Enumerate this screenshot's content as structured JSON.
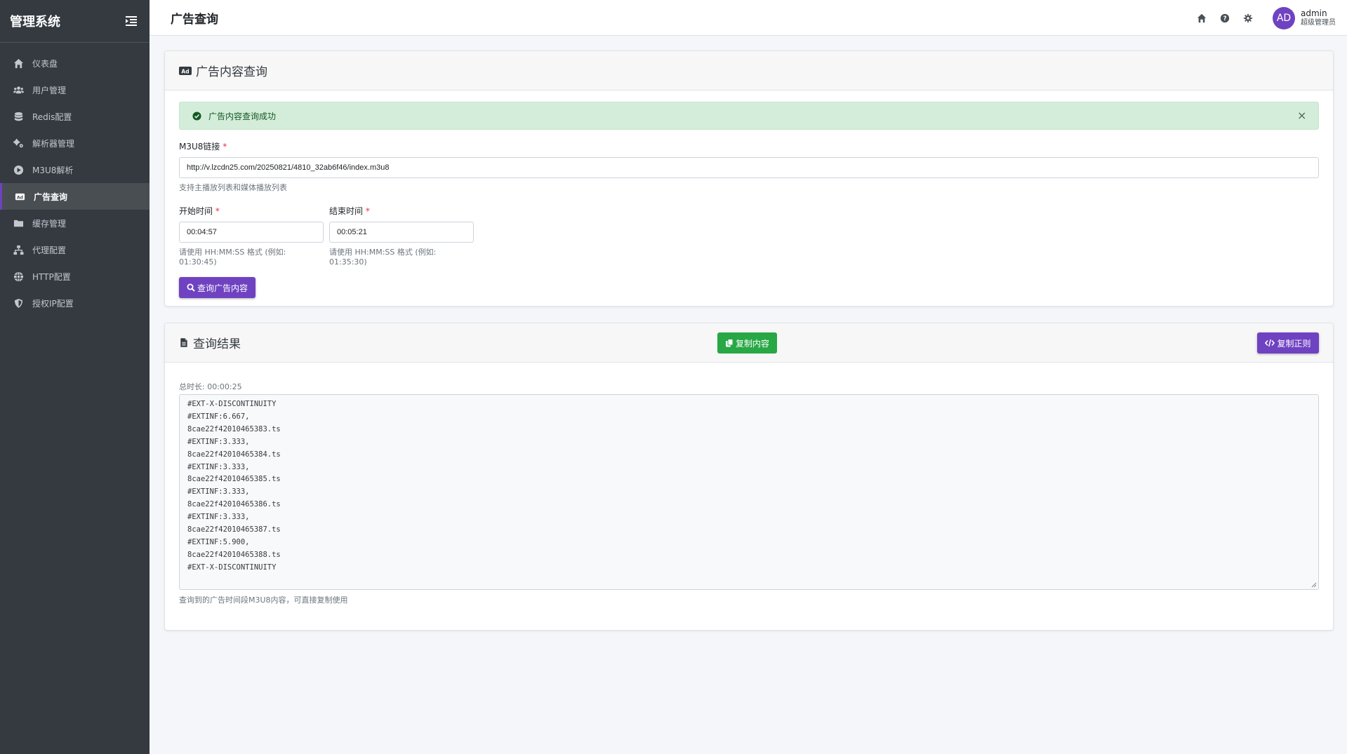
{
  "sidebar": {
    "brand": "管理系统",
    "items": [
      {
        "label": "仪表盘",
        "icon": "home-icon"
      },
      {
        "label": "用户管理",
        "icon": "users-icon"
      },
      {
        "label": "Redis配置",
        "icon": "database-icon"
      },
      {
        "label": "解析器管理",
        "icon": "gears-icon"
      },
      {
        "label": "M3U8解析",
        "icon": "play-circle-icon"
      },
      {
        "label": "广告查询",
        "icon": "ad-icon",
        "active": true
      },
      {
        "label": "缓存管理",
        "icon": "folder-icon"
      },
      {
        "label": "代理配置",
        "icon": "sitemap-icon"
      },
      {
        "label": "HTTP配置",
        "icon": "globe-icon"
      },
      {
        "label": "授权IP配置",
        "icon": "shield-icon"
      }
    ]
  },
  "header": {
    "title": "广告查询",
    "avatar_initials": "AD",
    "user_name": "admin",
    "user_role": "超级管理员"
  },
  "query_card": {
    "title": "广告内容查询",
    "alert_text": "广告内容查询成功",
    "alert_close": "×",
    "m3u8_label": "M3U8链接",
    "required_mark": "*",
    "m3u8_value": "http://v.lzcdn25.com/20250821/4810_32ab6f46/index.m3u8",
    "m3u8_help": "支持主播放列表和媒体播放列表",
    "start_label": "开始时间",
    "start_value": "00:04:57",
    "start_help": "请使用 HH:MM:SS 格式 (例如: 01:30:45)",
    "end_label": "结束时间",
    "end_value": "00:05:21",
    "end_help": "请使用 HH:MM:SS 格式 (例如: 01:35:30)",
    "submit_label": "查询广告内容"
  },
  "result_card": {
    "title": "查询结果",
    "copy_content_label": "复制内容",
    "copy_regex_label": "复制正则",
    "total_duration": "总时长: 00:00:25",
    "content": "#EXT-X-DISCONTINUITY\n#EXTINF:6.667,\n8cae22f42010465383.ts\n#EXTINF:3.333,\n8cae22f42010465384.ts\n#EXTINF:3.333,\n8cae22f42010465385.ts\n#EXTINF:3.333,\n8cae22f42010465386.ts\n#EXTINF:3.333,\n8cae22f42010465387.ts\n#EXTINF:5.900,\n8cae22f42010465388.ts\n#EXT-X-DISCONTINUITY",
    "help": "查询到的广告时间段M3U8内容，可直接复制使用"
  },
  "colors": {
    "sidebar_bg": "#343a40",
    "accent": "#6f42c1",
    "success": "#28a745",
    "alert_bg": "#d4edda"
  }
}
